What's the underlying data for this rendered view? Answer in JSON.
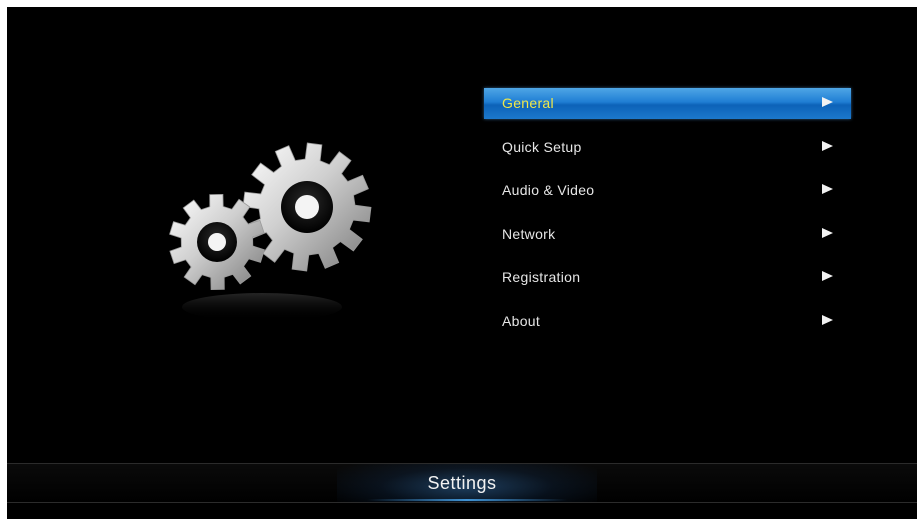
{
  "menu": {
    "items": [
      {
        "label": "General",
        "selected": true
      },
      {
        "label": "Quick Setup",
        "selected": false
      },
      {
        "label": "Audio & Video",
        "selected": false
      },
      {
        "label": "Network",
        "selected": false
      },
      {
        "label": "Registration",
        "selected": false
      },
      {
        "label": "About",
        "selected": false
      }
    ]
  },
  "footer": {
    "title": "Settings"
  },
  "icons": {
    "illustration": "gears-icon",
    "item_arrow": "chevron-right-icon"
  },
  "colors": {
    "background": "#000000",
    "selection": "#1f7ed4",
    "selected_label": "#f0e84a",
    "label": "#e6e6e6"
  }
}
